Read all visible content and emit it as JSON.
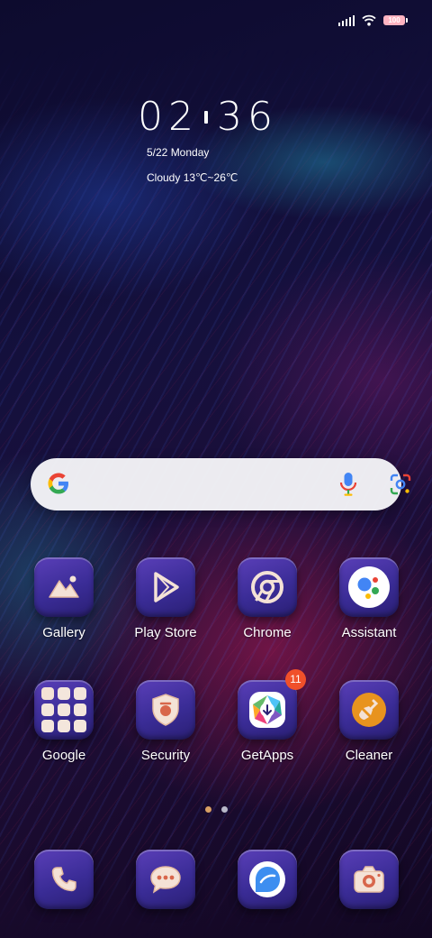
{
  "status_bar": {
    "battery_level": "100",
    "colors": {
      "battery": "#ffb3c1"
    },
    "icons": [
      "signal-icon",
      "wifi-icon",
      "battery-icon"
    ]
  },
  "clock_widget": {
    "time_hours": "02",
    "time_minutes": "36",
    "date": "5/22 Monday",
    "weather": "Cloudy 13℃~26℃"
  },
  "search_bar": {
    "icons": [
      "google-g-icon",
      "microphone-icon",
      "google-lens-icon"
    ]
  },
  "apps": [
    {
      "label": "Gallery",
      "icon": "gallery-icon"
    },
    {
      "label": "Play Store",
      "icon": "play-store-icon"
    },
    {
      "label": "Chrome",
      "icon": "chrome-icon"
    },
    {
      "label": "Assistant",
      "icon": "assistant-icon"
    },
    {
      "label": "Google",
      "icon": "google-folder-icon"
    },
    {
      "label": "Security",
      "icon": "security-shield-icon"
    },
    {
      "label": "GetApps",
      "icon": "getapps-icon",
      "badge": "11"
    },
    {
      "label": "Cleaner",
      "icon": "cleaner-brush-icon"
    }
  ],
  "page_indicator": {
    "total": 2,
    "current": 1,
    "colors": {
      "active": "#d9a064",
      "inactive": "#b8b8c8"
    }
  },
  "dock": [
    {
      "icon": "phone-icon"
    },
    {
      "icon": "messages-icon"
    },
    {
      "icon": "browser-icon"
    },
    {
      "icon": "camera-icon"
    }
  ],
  "colors": {
    "icon_tile": "#4a34a8",
    "icon_glyph": "#f4e2d6",
    "badge": "#f0502a"
  }
}
